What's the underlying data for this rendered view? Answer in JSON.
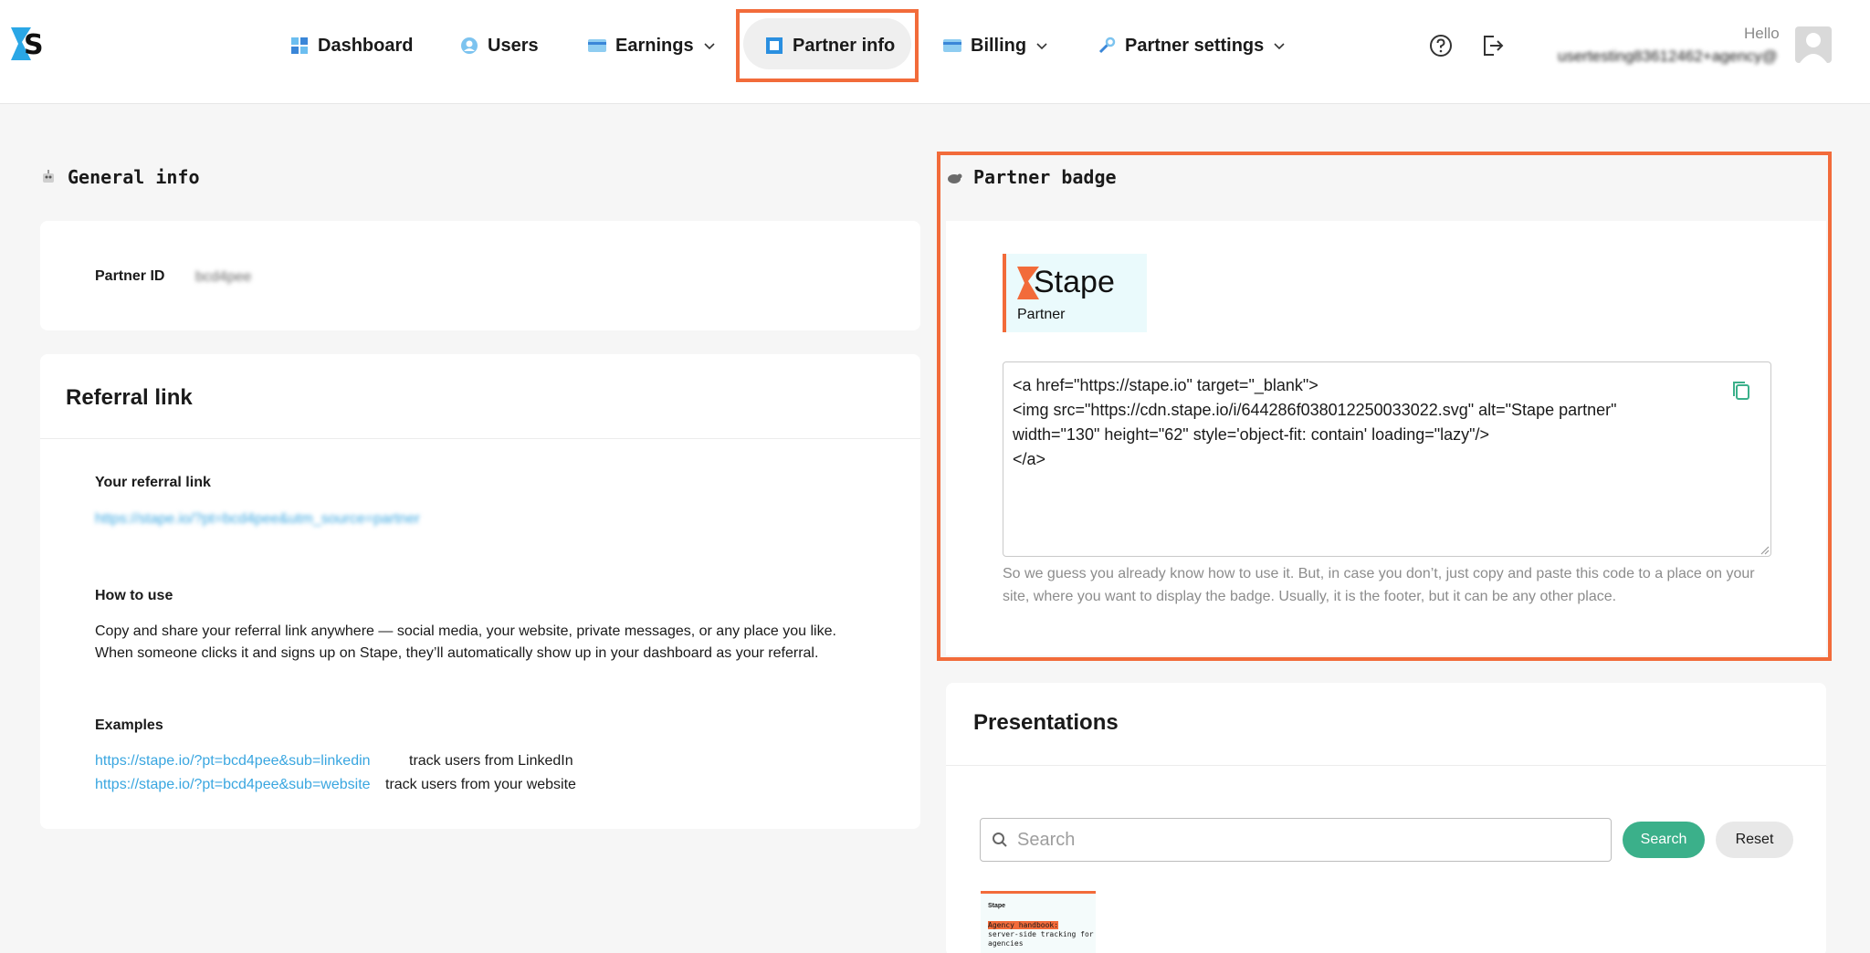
{
  "header": {
    "nav": [
      {
        "label": "Dashboard"
      },
      {
        "label": "Users"
      },
      {
        "label": "Earnings"
      },
      {
        "label": "Partner info"
      },
      {
        "label": "Billing"
      },
      {
        "label": "Partner settings"
      }
    ],
    "active_nav": "Partner info",
    "hello": "Hello",
    "user_email": "usertesting83612462+agency@..."
  },
  "general_info": {
    "title": "General info",
    "partner_id_label": "Partner ID",
    "partner_id_value": "bcd4pee"
  },
  "referral": {
    "title": "Referral link",
    "your_link_label": "Your referral link",
    "your_link_value": "https://stape.io/?pt=bcd4pee&utm_source=partner",
    "how_to_use_label": "How to use",
    "how_to_use_line1": "Copy and share your referral link anywhere — social media, your website, private messages, or any place you like.",
    "how_to_use_line2": "When someone clicks it and signs up on Stape, they’ll automatically show up in your dashboard as your referral.",
    "examples_label": "Examples",
    "example1_link": "https://stape.io/?pt=bcd4pee&sub=linkedin",
    "example1_text": "track users from LinkedIn",
    "example2_link": "https://stape.io/?pt=bcd4pee&sub=website",
    "example2_text": "track users from your website"
  },
  "partner_badge": {
    "title": "Partner badge",
    "badge_brand": "Stape",
    "badge_sub": "Partner",
    "code": "<a href=\"https://stape.io\" target=\"_blank\">\n<img src=\"https://cdn.stape.io/i/644286f038012250033022.svg\" alt=\"Stape partner\"\nwidth=\"130\" height=\"62\" style='object-fit: contain' loading=\"lazy\"/>\n</a>",
    "hint": "So we guess you already know how to use it. But, in case you don’t, just copy and paste this code to a place on your site, where you want to display the badge. Usually, it is the footer, but it can be any other place."
  },
  "presentations": {
    "title": "Presentations",
    "search_placeholder": "Search",
    "search_button": "Search",
    "reset_button": "Reset",
    "thumb_brand": "Stape",
    "thumb_title_hl": "Agency handbook:",
    "thumb_title_rest": "server-side tracking for agencies"
  },
  "colors": {
    "accent": "#f26b3a",
    "link": "#39a6e0",
    "primary_button": "#3bb08a"
  }
}
